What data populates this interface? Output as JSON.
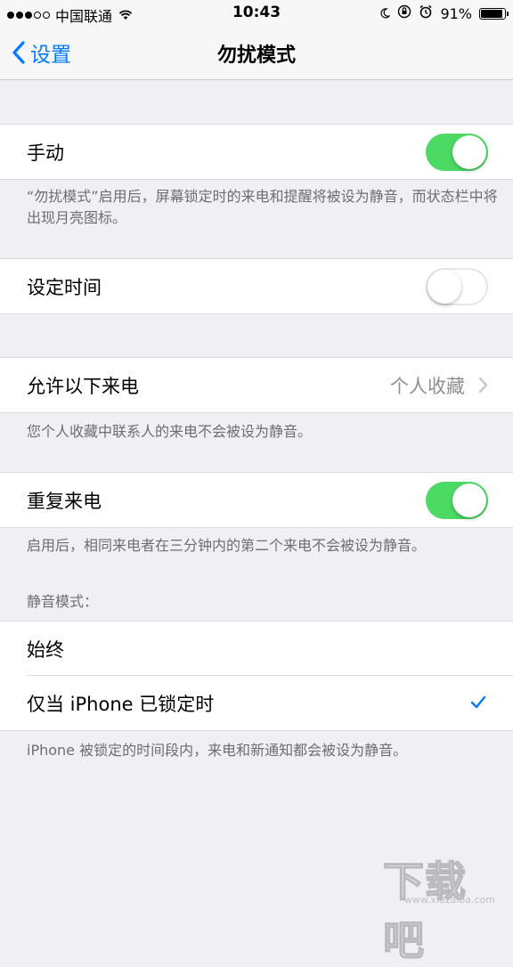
{
  "status_bar": {
    "carrier": "中国联通",
    "time": "10:43",
    "battery_pct": "91%",
    "battery_level": 0.91,
    "signal_bars": 3,
    "icons": [
      "wifi-icon",
      "moon-icon",
      "rotation-lock-icon",
      "alarm-icon",
      "battery-icon"
    ]
  },
  "nav": {
    "back_label": "设置",
    "title": "勿扰模式"
  },
  "manual": {
    "label": "手动",
    "on": true,
    "note": "“勿扰模式”启用后，屏幕锁定时的来电和提醒将被设为静音，而状态栏中将出现月亮图标。"
  },
  "scheduled": {
    "label": "设定时间",
    "on": false
  },
  "allow_calls": {
    "label": "允许以下来电",
    "value": "个人收藏",
    "note": "您个人收藏中联系人的来电不会被设为静音。"
  },
  "repeated_calls": {
    "label": "重复来电",
    "on": true,
    "note": "启用后，相同来电者在三分钟内的第二个来电不会被设为静音。"
  },
  "silence": {
    "header": "静音模式：",
    "options": [
      {
        "label": "始终",
        "selected": false
      },
      {
        "label": "仅当 iPhone 已锁定时",
        "selected": true
      }
    ],
    "note": "iPhone 被锁定的时间段内，来电和新通知都会被设为静音。"
  },
  "watermark": {
    "main": "下载吧",
    "sub": "www.xiazaiba.com"
  },
  "colors": {
    "accent": "#007aff",
    "toggle_on": "#4cd964",
    "background": "#efeff4"
  }
}
